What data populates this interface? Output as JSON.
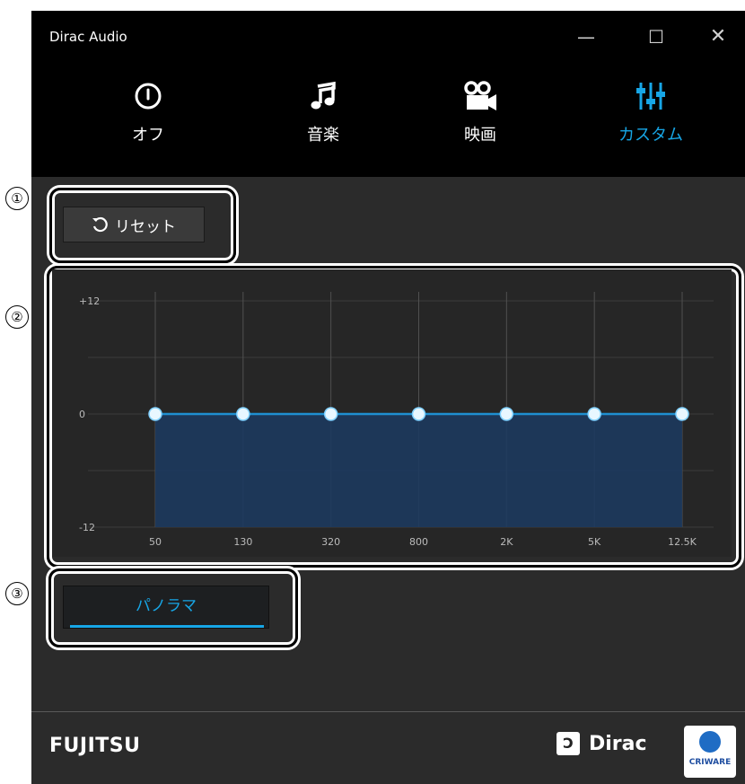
{
  "window": {
    "title": "Dirac Audio",
    "controls": {
      "minimize": "—",
      "maximize": "☐",
      "close": "✕"
    }
  },
  "modes": [
    {
      "label": "オフ",
      "icon": "power-icon",
      "active": false
    },
    {
      "label": "音楽",
      "icon": "music-note-icon",
      "active": false
    },
    {
      "label": "映画",
      "icon": "movie-camera-icon",
      "active": false
    },
    {
      "label": "カスタム",
      "icon": "equalizer-sliders-icon",
      "active": true
    }
  ],
  "callouts": [
    "①",
    "②",
    "③"
  ],
  "reset_button": {
    "label": "リセット",
    "icon": "reset-icon"
  },
  "chart_data": {
    "type": "line",
    "categories": [
      "50",
      "130",
      "320",
      "800",
      "2K",
      "5K",
      "12.5K"
    ],
    "series": [
      {
        "values": [
          0,
          0,
          0,
          0,
          0,
          0,
          0
        ]
      }
    ],
    "ylim": [
      -12,
      12
    ],
    "yticks": [
      "+12",
      "0",
      "-12"
    ],
    "grid": true,
    "fill": "area",
    "colors": {
      "line": "#1f8fd0",
      "point": "#e8f7ff",
      "fill": "#1d3a5e"
    }
  },
  "panorama_button": {
    "label": "パノラマ"
  },
  "footer": {
    "fujitsu": "FUJITSU",
    "dirac": "Dirac",
    "dirac_mark": "Ɔ",
    "criware": "CRIWARE"
  },
  "colors": {
    "accent": "#17a6e6",
    "titlebar": "#000000",
    "body": "#2b2b2b"
  }
}
